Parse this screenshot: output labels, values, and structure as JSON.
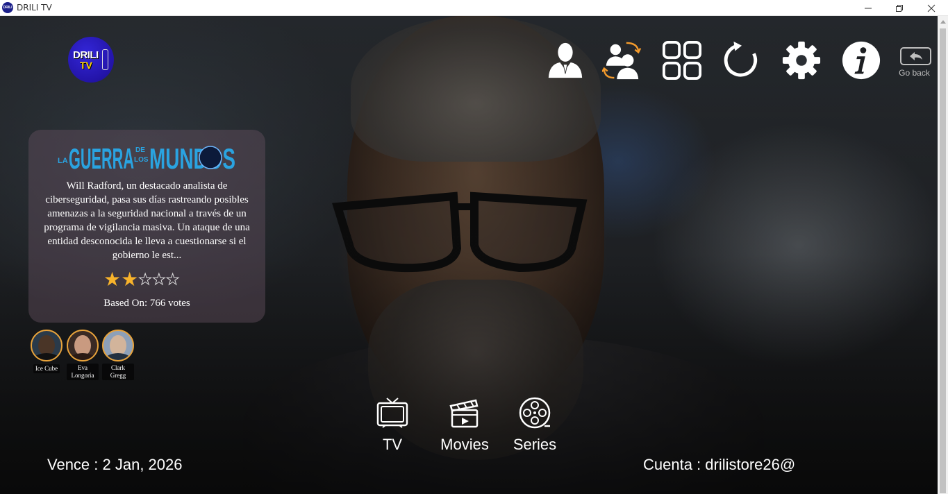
{
  "window": {
    "title": "DRILI TV",
    "app_icon_text": "DRILI"
  },
  "logo": {
    "line1": "DRILI",
    "line2": "TV"
  },
  "toolbar": {
    "buttons": [
      {
        "name": "profile",
        "icon": "user-icon"
      },
      {
        "name": "switch-user",
        "icon": "switch-users-icon"
      },
      {
        "name": "grid",
        "icon": "grid-icon"
      },
      {
        "name": "refresh",
        "icon": "refresh-icon"
      },
      {
        "name": "settings",
        "icon": "gear-icon"
      },
      {
        "name": "info",
        "icon": "info-icon"
      }
    ],
    "go_back_label": "Go back"
  },
  "featured": {
    "title_parts": {
      "la": "LA",
      "guerra": "GUERRA",
      "de": "DE",
      "los": "LOS",
      "mundos": "MUNDOS"
    },
    "description": "Will Radford, un destacado analista de ciberseguridad, pasa sus días rastreando posibles amenazas a la seguridad nacional a través de un programa de vigilancia masiva. Un ataque de una entidad desconocida le lleva a cuestionarse si el gobierno le est...",
    "rating_stars": 2,
    "rating_max": 5,
    "votes_label": "Based On:  766 votes"
  },
  "cast": [
    {
      "name": "Ice Cube",
      "accent": "#4a3527"
    },
    {
      "name": "Eva Longoria",
      "accent": "#6b4a3a"
    },
    {
      "name": "Clark Gregg",
      "accent": "#d2b49b"
    }
  ],
  "nav": [
    {
      "label": "TV",
      "icon": "tv-icon"
    },
    {
      "label": "Movies",
      "icon": "clapperboard-icon"
    },
    {
      "label": "Series",
      "icon": "film-reel-icon"
    }
  ],
  "footer": {
    "expiry": "Vence : 2 Jan, 2026",
    "account": "Cuenta : drilistore26@"
  },
  "colors": {
    "accent": "#f7b32b",
    "logo_bg": "#2314a8",
    "title_blue": "#2aa3e0"
  }
}
